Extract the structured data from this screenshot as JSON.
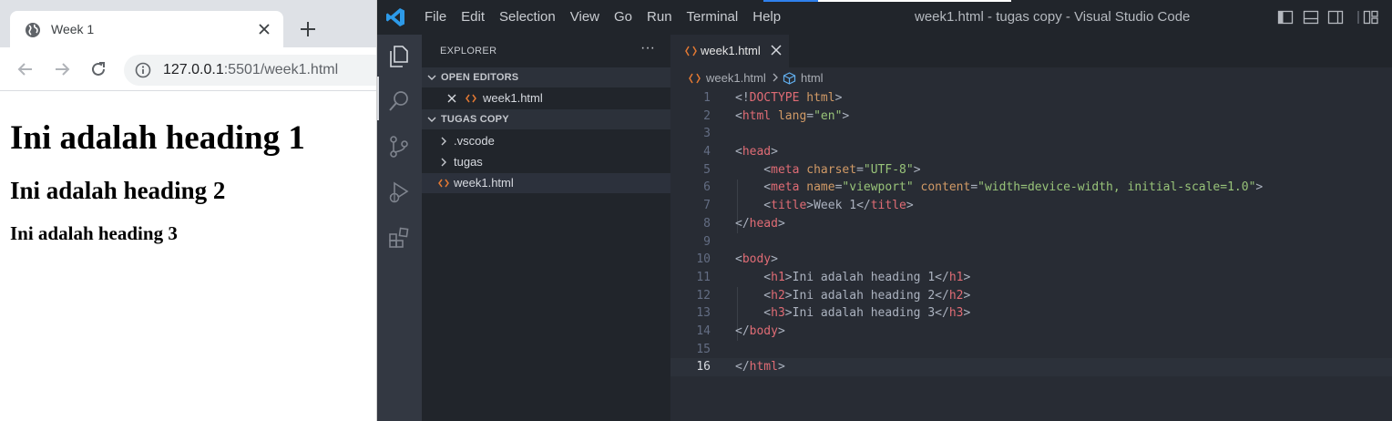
{
  "browser": {
    "tab_title": "Week 1",
    "url_host": "127.0.0.1",
    "url_rest": ":5501/week1.html",
    "page": {
      "h1": "Ini adalah heading 1",
      "h2": "Ini adalah heading 2",
      "h3": "Ini adalah heading 3"
    }
  },
  "vscode": {
    "menu": [
      "File",
      "Edit",
      "Selection",
      "View",
      "Go",
      "Run",
      "Terminal",
      "Help"
    ],
    "window_title": "week1.html - tugas copy - Visual Studio Code",
    "sidebar": {
      "header": "EXPLORER",
      "more": "···",
      "open_editors_label": "OPEN EDITORS",
      "open_editor_file": "week1.html",
      "folder_label": "TUGAS COPY",
      "items": [
        {
          "name": ".vscode",
          "type": "folder"
        },
        {
          "name": "tugas",
          "type": "folder"
        },
        {
          "name": "week1.html",
          "type": "file"
        }
      ]
    },
    "editor": {
      "tab_name": "week1.html",
      "breadcrumb_file": "week1.html",
      "breadcrumb_node": "html",
      "current_line": 16,
      "lines": [
        {
          "n": "1",
          "tokens": [
            [
              "p",
              "<!"
            ],
            [
              "d",
              "DOCTYPE"
            ],
            [
              "p",
              " "
            ],
            [
              "a",
              "html"
            ],
            [
              "p",
              ">"
            ]
          ]
        },
        {
          "n": "2",
          "tokens": [
            [
              "p",
              "<"
            ],
            [
              "t",
              "html"
            ],
            [
              "p",
              " "
            ],
            [
              "a",
              "lang"
            ],
            [
              "p",
              "="
            ],
            [
              "s",
              "\"en\""
            ],
            [
              "p",
              ">"
            ]
          ]
        },
        {
          "n": "3",
          "tokens": []
        },
        {
          "n": "4",
          "tokens": [
            [
              "p",
              "<"
            ],
            [
              "t",
              "head"
            ],
            [
              "p",
              ">"
            ]
          ]
        },
        {
          "n": "5",
          "tokens": [
            [
              "p",
              "    <"
            ],
            [
              "t",
              "meta"
            ],
            [
              "p",
              " "
            ],
            [
              "a",
              "charset"
            ],
            [
              "p",
              "="
            ],
            [
              "s",
              "\"UTF-8\""
            ],
            [
              "p",
              ">"
            ]
          ]
        },
        {
          "n": "6",
          "tokens": [
            [
              "p",
              "    <"
            ],
            [
              "t",
              "meta"
            ],
            [
              "p",
              " "
            ],
            [
              "a",
              "name"
            ],
            [
              "p",
              "="
            ],
            [
              "s",
              "\"viewport\""
            ],
            [
              "p",
              " "
            ],
            [
              "a",
              "content"
            ],
            [
              "p",
              "="
            ],
            [
              "s",
              "\"width=device-width, initial-scale=1.0\""
            ],
            [
              "p",
              ">"
            ]
          ]
        },
        {
          "n": "7",
          "tokens": [
            [
              "p",
              "    <"
            ],
            [
              "t",
              "title"
            ],
            [
              "p",
              ">"
            ],
            [
              "x",
              "Week 1"
            ],
            [
              "p",
              "</"
            ],
            [
              "t",
              "title"
            ],
            [
              "p",
              ">"
            ]
          ]
        },
        {
          "n": "8",
          "tokens": [
            [
              "p",
              "</"
            ],
            [
              "t",
              "head"
            ],
            [
              "p",
              ">"
            ]
          ]
        },
        {
          "n": "9",
          "tokens": []
        },
        {
          "n": "10",
          "tokens": [
            [
              "p",
              "<"
            ],
            [
              "t",
              "body"
            ],
            [
              "p",
              ">"
            ]
          ]
        },
        {
          "n": "11",
          "tokens": [
            [
              "p",
              "    <"
            ],
            [
              "t",
              "h1"
            ],
            [
              "p",
              ">"
            ],
            [
              "x",
              "Ini adalah heading 1"
            ],
            [
              "p",
              "</"
            ],
            [
              "t",
              "h1"
            ],
            [
              "p",
              ">"
            ]
          ]
        },
        {
          "n": "12",
          "tokens": [
            [
              "p",
              "    <"
            ],
            [
              "t",
              "h2"
            ],
            [
              "p",
              ">"
            ],
            [
              "x",
              "Ini adalah heading 2"
            ],
            [
              "p",
              "</"
            ],
            [
              "t",
              "h2"
            ],
            [
              "p",
              ">"
            ]
          ]
        },
        {
          "n": "13",
          "tokens": [
            [
              "p",
              "    <"
            ],
            [
              "t",
              "h3"
            ],
            [
              "p",
              ">"
            ],
            [
              "x",
              "Ini adalah heading 3"
            ],
            [
              "p",
              "</"
            ],
            [
              "t",
              "h3"
            ],
            [
              "p",
              ">"
            ]
          ]
        },
        {
          "n": "14",
          "tokens": [
            [
              "p",
              "</"
            ],
            [
              "t",
              "body"
            ],
            [
              "p",
              ">"
            ]
          ]
        },
        {
          "n": "15",
          "tokens": []
        },
        {
          "n": "16",
          "tokens": [
            [
              "p",
              "</"
            ],
            [
              "t",
              "html"
            ],
            [
              "p",
              ">"
            ]
          ]
        }
      ]
    }
  }
}
